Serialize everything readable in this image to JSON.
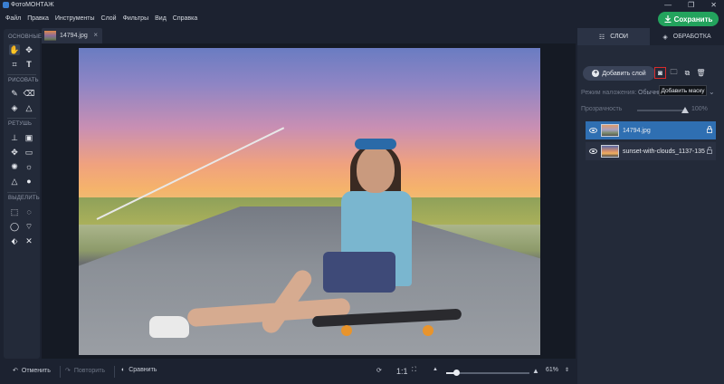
{
  "app": {
    "title": "ФотоМОНТАЖ",
    "window_controls": [
      "—",
      "❐",
      "✕"
    ]
  },
  "menu": [
    "Файл",
    "Правка",
    "Инструменты",
    "Слой",
    "Фильтры",
    "Вид",
    "Справка"
  ],
  "save_button": "Сохранить",
  "tools": {
    "sections": [
      "ОСНОВНЫЕ",
      "РИСОВАТЬ",
      "РЕТУШЬ",
      "ВЫДЕЛИТЬ"
    ]
  },
  "document_tab": {
    "name": "14794.jpg",
    "close": "×"
  },
  "bottom": {
    "undo": "Отменить",
    "redo": "Повторить",
    "compare": "Сравнить",
    "actual_size": "1:1",
    "zoom": "61%",
    "zoom_fraction": 0.12
  },
  "right_panel": {
    "tabs": [
      "СЛОИ",
      "ОБРАБОТКА"
    ],
    "add_layer": "Добавить слой",
    "tooltip": "Добавить маску",
    "blend_label": "Режим наложения:",
    "blend_value": "Обычный",
    "opacity_label": "Прозрачность",
    "opacity_value": "100%",
    "layers": [
      {
        "name": "14794.jpg",
        "selected": true
      },
      {
        "name": "sunset-with-clouds_1137-135",
        "selected": false
      }
    ]
  },
  "colors": {
    "accent_save": "#23a35d",
    "selected_layer": "#2f6fb2",
    "highlight": "#d92b2b"
  }
}
